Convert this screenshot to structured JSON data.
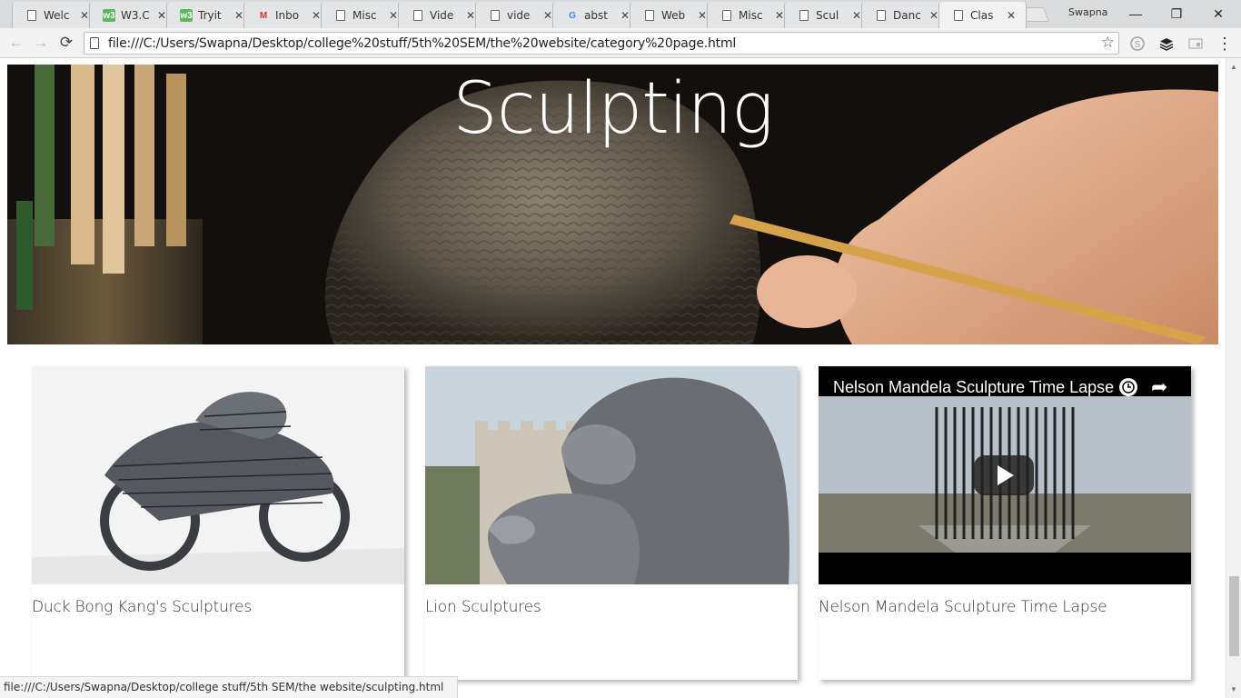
{
  "browser": {
    "tabs": [
      {
        "title": "Welc",
        "icon": "page-icon"
      },
      {
        "title": "W3.C",
        "icon": "w3schools-icon"
      },
      {
        "title": "Tryit",
        "icon": "w3schools-icon"
      },
      {
        "title": "Inbo",
        "icon": "gmail-icon"
      },
      {
        "title": "Misc",
        "icon": "page-icon"
      },
      {
        "title": "Vide",
        "icon": "page-icon"
      },
      {
        "title": "vide",
        "icon": "page-icon"
      },
      {
        "title": "abst",
        "icon": "google-icon"
      },
      {
        "title": "Web",
        "icon": "page-icon"
      },
      {
        "title": "Misc",
        "icon": "page-icon"
      },
      {
        "title": "Scul",
        "icon": "page-icon"
      },
      {
        "title": "Danc",
        "icon": "page-icon"
      },
      {
        "title": "Clas",
        "icon": "page-icon"
      }
    ],
    "favicon_labels": {
      "w3": "w3",
      "gmail": "M",
      "google": "G"
    },
    "close_glyph": "✕",
    "profile_name": "Swapna",
    "url": "file:///C:/Users/Swapna/Desktop/college%20stuff/5th%20SEM/the%20website/category%20page.html",
    "status_url": "file:///C:/Users/Swapna/Desktop/college stuff/5th SEM/the website/sculpting.html",
    "window_controls": {
      "minimize": "—",
      "restore": "❐",
      "close": "✕"
    },
    "nav": {
      "back": "←",
      "forward": "→",
      "reload": "⟳"
    },
    "star_glyph": "☆",
    "extensions": [
      "skype-icon",
      "layers-icon",
      "cast-icon"
    ],
    "menu_glyph": "⋮"
  },
  "page": {
    "hero_title": "Sculpting",
    "cards": [
      {
        "caption": "Duck Bong Kang's Sculptures",
        "image": "motorcycle-sculpture"
      },
      {
        "caption": "Lion Sculptures",
        "image": "lion-sculpture"
      },
      {
        "caption": "Nelson Mandela Sculpture Time Lapse",
        "image": "video-thumbnail"
      }
    ],
    "video": {
      "title": "Nelson Mandela Sculpture Time Lapse",
      "clock_glyph": "🕓",
      "share_glyph": "➦"
    }
  },
  "colors": {
    "tabstrip": "#dadbdc",
    "toolbar": "#f2f2f2",
    "hero_bg": "#1a1612",
    "caption_text": "#333333"
  }
}
